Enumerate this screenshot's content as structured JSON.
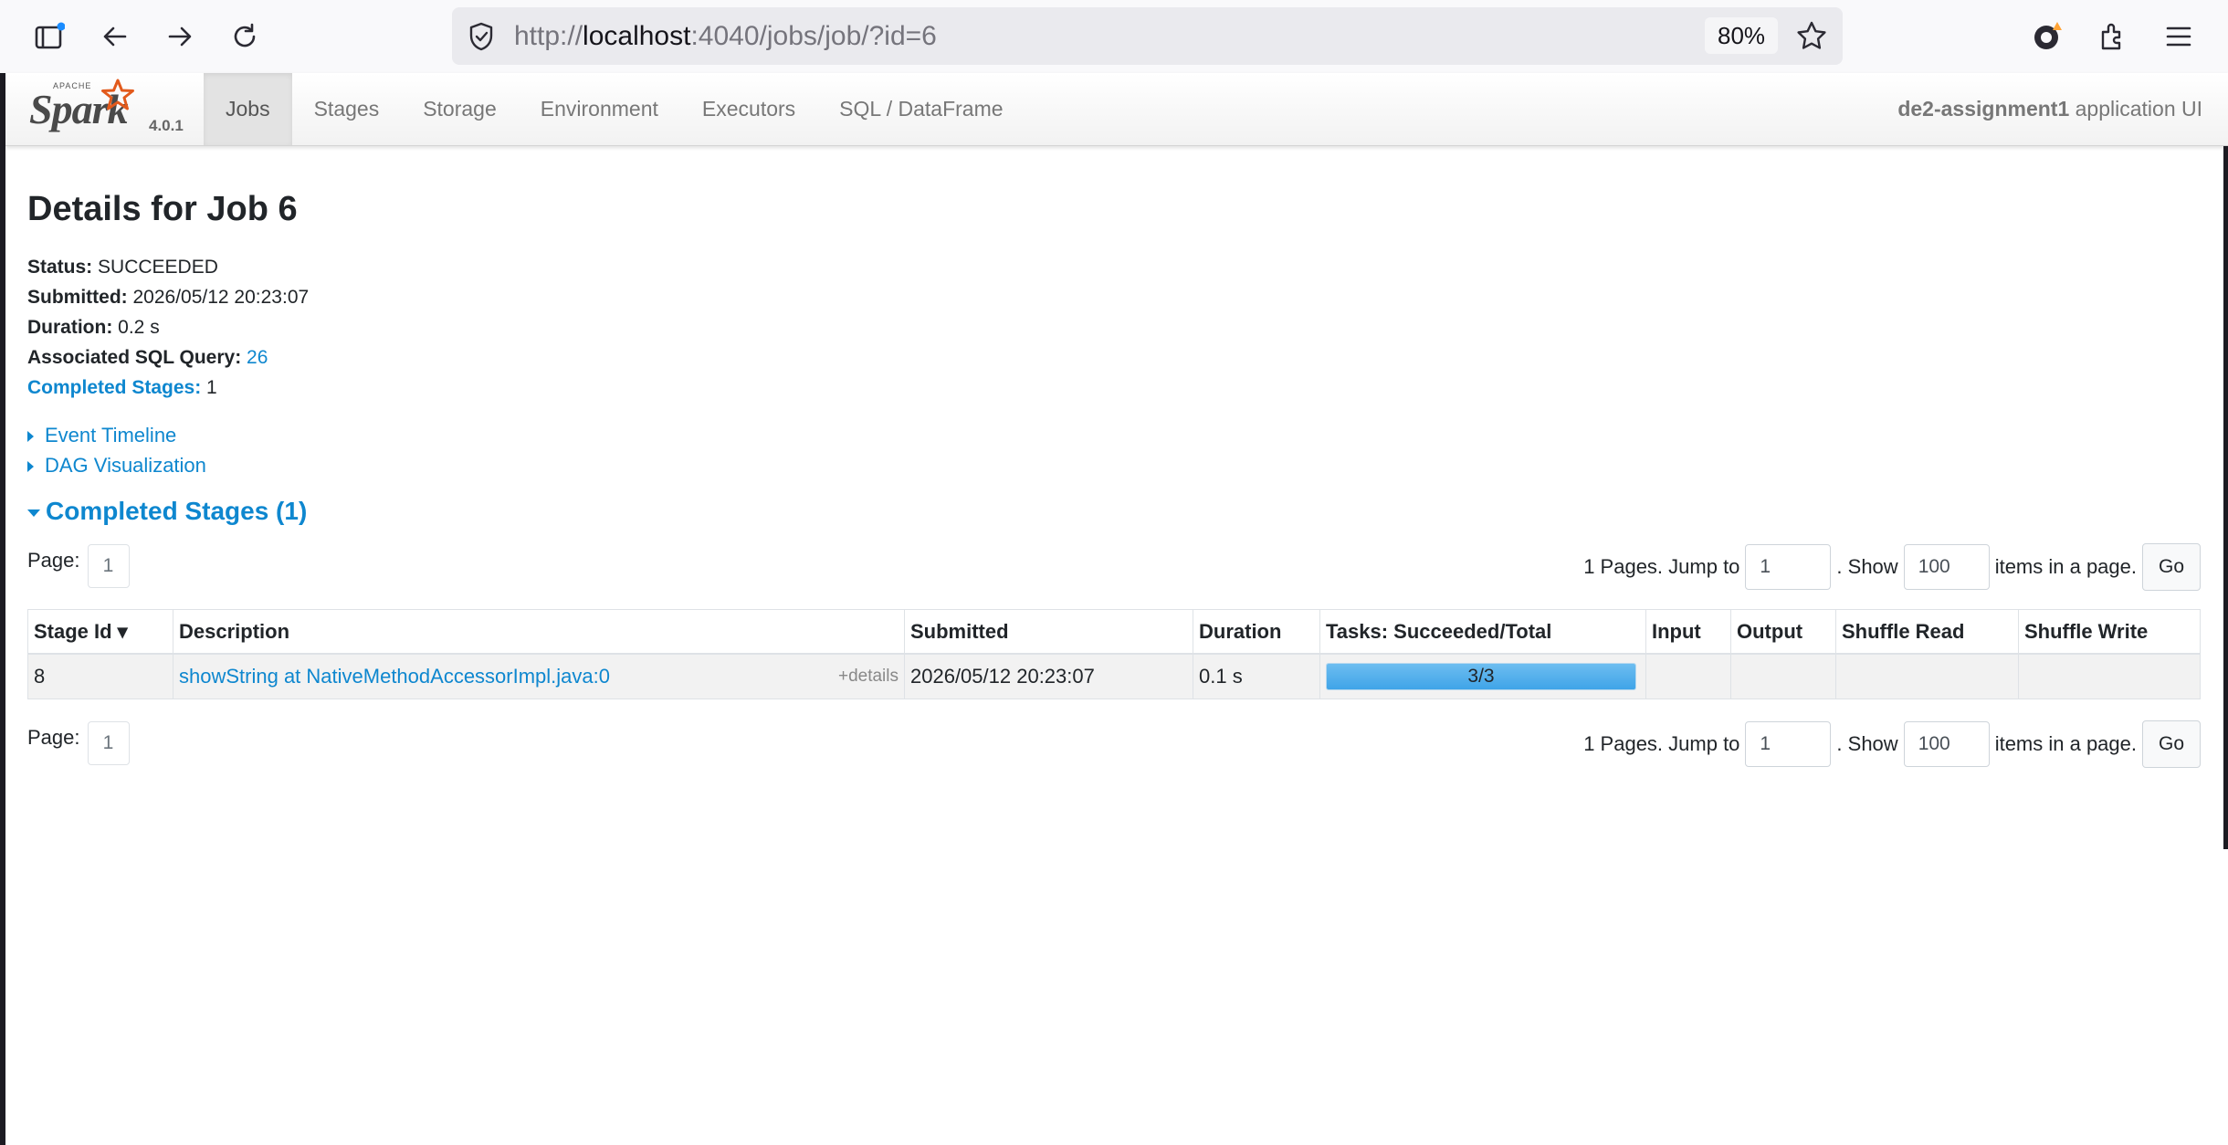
{
  "browser": {
    "url_prefix": "http://",
    "url_host": "localhost",
    "url_rest": ":4040/jobs/job/?id=6",
    "zoom": "80%"
  },
  "spark": {
    "brand_apache": "APACHE",
    "brand_name": "Spark",
    "version": "4.0.1",
    "tabs": [
      {
        "label": "Jobs",
        "active": true
      },
      {
        "label": "Stages",
        "active": false
      },
      {
        "label": "Storage",
        "active": false
      },
      {
        "label": "Environment",
        "active": false
      },
      {
        "label": "Executors",
        "active": false
      },
      {
        "label": "SQL / DataFrame",
        "active": false
      }
    ],
    "app_name": "de2-assignment1",
    "app_suffix": "application UI"
  },
  "job": {
    "title": "Details for Job 6",
    "status_label": "Status:",
    "status": "SUCCEEDED",
    "submitted_label": "Submitted:",
    "submitted": "2026/05/12 20:23:07",
    "duration_label": "Duration:",
    "duration": "0.2 s",
    "sql_label": "Associated SQL Query:",
    "sql_query": "26",
    "completed_label": "Completed Stages:",
    "completed_count": "1"
  },
  "toggles": {
    "event_timeline": "Event Timeline",
    "dag": "DAG Visualization",
    "completed_stages": "Completed Stages (1)"
  },
  "pager": {
    "page_label": "Page:",
    "current_page": "1",
    "pages_text": "1 Pages. Jump to",
    "jump_value": "1",
    "show_text": ". Show",
    "show_value": "100",
    "items_text": "items in a page.",
    "go": "Go"
  },
  "table": {
    "headers": [
      "Stage Id ▾",
      "Description",
      "Submitted",
      "Duration",
      "Tasks: Succeeded/Total",
      "Input",
      "Output",
      "Shuffle Read",
      "Shuffle Write"
    ],
    "rows": [
      {
        "stage_id": "8",
        "description": "showString at NativeMethodAccessorImpl.java:0",
        "details": "+details",
        "submitted": "2026/05/12 20:23:07",
        "duration": "0.1 s",
        "tasks": "3/3",
        "tasks_fraction": 1.0,
        "input": "",
        "output": "",
        "shuffle_read": "",
        "shuffle_write": ""
      }
    ]
  }
}
